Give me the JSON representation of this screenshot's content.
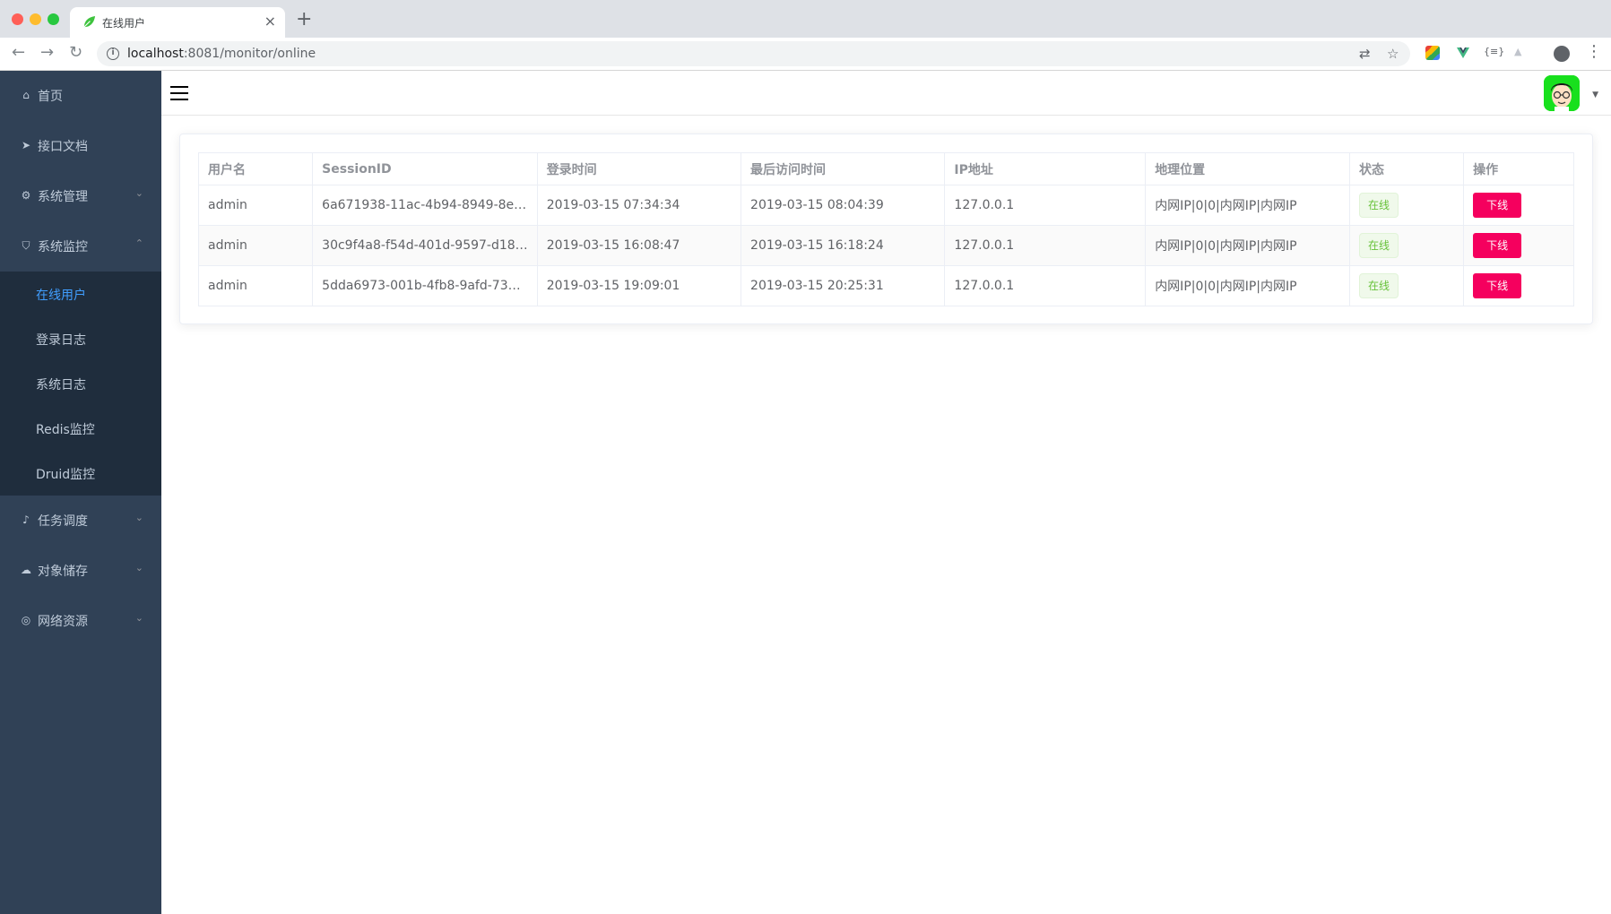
{
  "browser": {
    "tab_title": "在线用户",
    "url_host": "localhost",
    "url_rest": ":8081/monitor/online",
    "new_tab": "+",
    "close_tab": "×"
  },
  "sidebar": {
    "items": [
      {
        "label": "首页",
        "icon": "home-icon"
      },
      {
        "label": "接口文档",
        "icon": "paper-plane-icon"
      },
      {
        "label": "系统管理",
        "icon": "gear-icon",
        "expandable": true
      },
      {
        "label": "系统监控",
        "icon": "shield-icon",
        "expandable": true,
        "expanded": true
      },
      {
        "label": "任务调度",
        "icon": "bell-icon",
        "expandable": true
      },
      {
        "label": "对象储存",
        "icon": "cloud-icon",
        "expandable": true
      },
      {
        "label": "网络资源",
        "icon": "globe-icon",
        "expandable": true
      }
    ],
    "submenu": [
      {
        "label": "在线用户",
        "active": true
      },
      {
        "label": "登录日志"
      },
      {
        "label": "系统日志"
      },
      {
        "label": "Redis监控"
      },
      {
        "label": "Druid监控"
      }
    ]
  },
  "table": {
    "headers": [
      "用户名",
      "SessionID",
      "登录时间",
      "最后访问时间",
      "IP地址",
      "地理位置",
      "状态",
      "操作"
    ],
    "rows": [
      [
        "admin",
        "6a671938-11ac-4b94-8949-8e…",
        "2019-03-15 07:34:34",
        "2019-03-15 08:04:39",
        "127.0.0.1",
        "内网IP|0|0|内网IP|内网IP",
        "在线",
        "下线"
      ],
      [
        "admin",
        "30c9f4a8-f54d-401d-9597-d18…",
        "2019-03-15 16:08:47",
        "2019-03-15 16:18:24",
        "127.0.0.1",
        "内网IP|0|0|内网IP|内网IP",
        "在线",
        "下线"
      ],
      [
        "admin",
        "5dda6973-001b-4fb8-9afd-73…",
        "2019-03-15 19:09:01",
        "2019-03-15 20:25:31",
        "127.0.0.1",
        "内网IP|0|0|内网IP|内网IP",
        "在线",
        "下线"
      ]
    ]
  },
  "colors": {
    "sidebar_bg": "#304156",
    "submenu_bg": "#1f2d3d",
    "active": "#409eff",
    "offline_button": "#f5005e",
    "online_tag": "#67c23a"
  }
}
